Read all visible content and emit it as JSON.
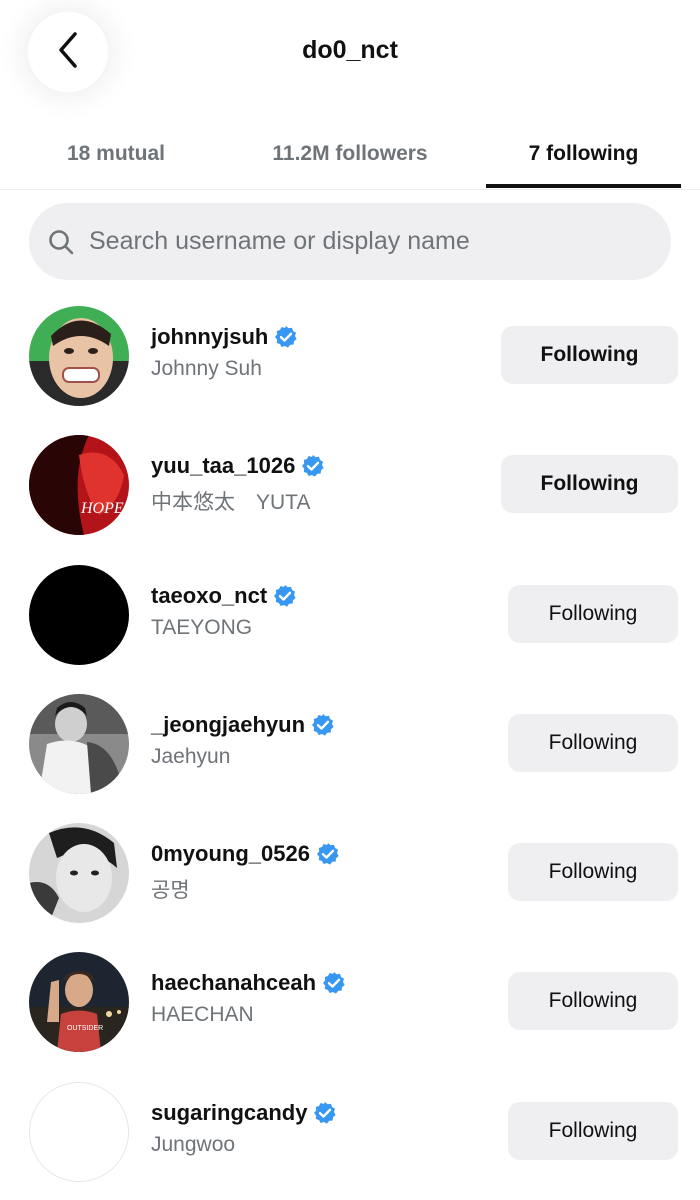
{
  "header": {
    "title": "do0_nct"
  },
  "tabs": [
    {
      "label": "18 mutual"
    },
    {
      "label": "11.2M followers"
    },
    {
      "label": "7 following",
      "active": true
    }
  ],
  "search": {
    "placeholder": "Search username or display name",
    "value": ""
  },
  "users": [
    {
      "username": "johnnyjsuh",
      "display_name": "Johnny Suh",
      "verified": true,
      "button": "Following"
    },
    {
      "username": "yuu_taa_1026",
      "display_name": "中本悠太　YUTA",
      "verified": true,
      "button": "Following"
    },
    {
      "username": "taeoxo_nct",
      "display_name": "TAEYONG",
      "verified": true,
      "button": "Following"
    },
    {
      "username": "_jeongjaehyun",
      "display_name": "Jaehyun",
      "verified": true,
      "button": "Following"
    },
    {
      "username": "0myoung_0526",
      "display_name": "공명",
      "verified": true,
      "button": "Following"
    },
    {
      "username": "haechanahceah",
      "display_name": "HAECHAN",
      "verified": true,
      "button": "Following"
    },
    {
      "username": "sugaringcandy",
      "display_name": "Jungwoo",
      "verified": true,
      "button": "Following"
    }
  ],
  "colors": {
    "verified_badge": "#3897f0",
    "secondary_text": "#6f7479",
    "button_bg": "#efeff2"
  }
}
